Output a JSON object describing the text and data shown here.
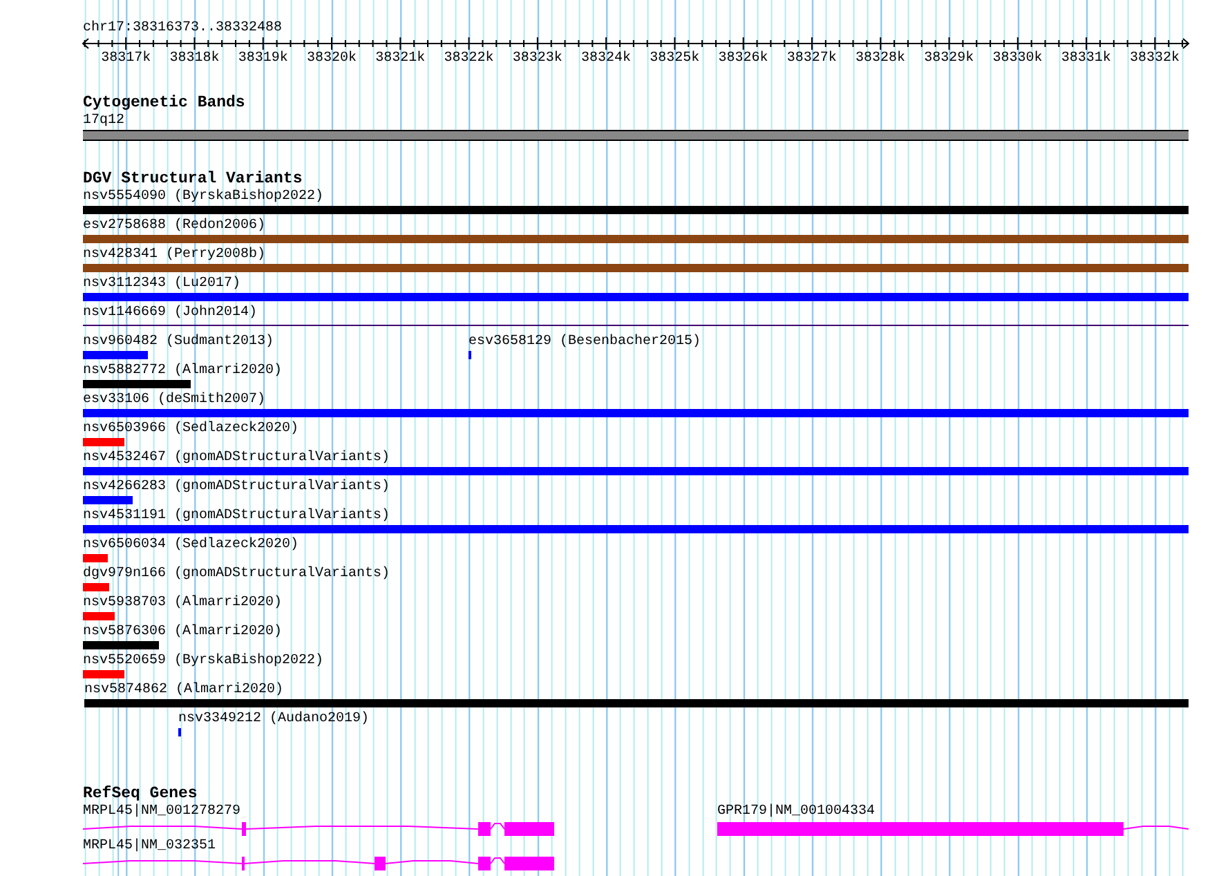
{
  "location": "chr17:38316373..38332488",
  "ruler": {
    "ticks": [
      "38317k",
      "38318k",
      "38319k",
      "38320k",
      "38321k",
      "38322k",
      "38323k",
      "38324k",
      "38325k",
      "38326k",
      "38327k",
      "38328k",
      "38329k",
      "38330k",
      "38331k",
      "38332k"
    ]
  },
  "cytogenetic_bands": {
    "title": "Cytogenetic Bands",
    "band": "17q12"
  },
  "dgv": {
    "title": "DGV Structural Variants",
    "rows": [
      {
        "items": [
          {
            "kind": "bar",
            "label": "nsv5554090 (ByrskaBishop2022)",
            "color": "#000000"
          }
        ]
      },
      {
        "items": [
          {
            "kind": "bar",
            "label": "esv2758688 (Redon2006)",
            "color": "#8b4513"
          }
        ]
      },
      {
        "items": [
          {
            "kind": "bar",
            "label": "nsv428341 (Perry2008b)",
            "color": "#8b4513"
          }
        ]
      },
      {
        "items": [
          {
            "kind": "bar",
            "label": "nsv3112343 (Lu2017)",
            "color": "#0000ff"
          }
        ]
      },
      {
        "items": [
          {
            "kind": "line",
            "label": "nsv1146669 (John2014)",
            "color": "#400070"
          }
        ]
      },
      {
        "items": [
          {
            "kind": "bar",
            "label": "nsv960482 (Sudmant2013)",
            "color": "#0000ff"
          },
          {
            "kind": "bar",
            "label": "esv3658129 (Besenbacher2015)",
            "color": "#0000ff"
          }
        ]
      },
      {
        "items": [
          {
            "kind": "bar",
            "label": "nsv5882772 (Almarri2020)",
            "color": "#000000"
          }
        ]
      },
      {
        "items": [
          {
            "kind": "bar",
            "label": "esv33106 (deSmith2007)",
            "color": "#0000ff"
          }
        ]
      },
      {
        "items": [
          {
            "kind": "bar",
            "label": "nsv6503966 (Sedlazeck2020)",
            "color": "#ff0000"
          }
        ]
      },
      {
        "items": [
          {
            "kind": "bar",
            "label": "nsv4532467 (gnomADStructuralVariants)",
            "color": "#0000ff"
          }
        ]
      },
      {
        "items": [
          {
            "kind": "bar",
            "label": "nsv4266283 (gnomADStructuralVariants)",
            "color": "#0000ff"
          }
        ]
      },
      {
        "items": [
          {
            "kind": "bar",
            "label": "nsv4531191 (gnomADStructuralVariants)",
            "color": "#0000ff"
          }
        ]
      },
      {
        "items": [
          {
            "kind": "bar",
            "label": "nsv6506034 (Sedlazeck2020)",
            "color": "#ff0000"
          }
        ]
      },
      {
        "items": [
          {
            "kind": "bar",
            "label": "dgv979n166 (gnomADStructuralVariants)",
            "color": "#ff0000"
          }
        ]
      },
      {
        "items": [
          {
            "kind": "bar",
            "label": "nsv5938703 (Almarri2020)",
            "color": "#ff0000"
          }
        ]
      },
      {
        "items": [
          {
            "kind": "bar",
            "label": "nsv5876306 (Almarri2020)",
            "color": "#000000"
          }
        ]
      },
      {
        "items": [
          {
            "kind": "bar",
            "label": "nsv5520659 (ByrskaBishop2022)",
            "color": "#ff0000"
          }
        ]
      },
      {
        "items": [
          {
            "kind": "bar",
            "label": "nsv5874862 (Almarri2020)",
            "color": "#000000"
          }
        ]
      },
      {
        "items": [
          {
            "kind": "bar",
            "label": "nsv3349212 (Audano2019)",
            "color": "#0000ff"
          }
        ]
      }
    ]
  },
  "refseq": {
    "title": "RefSeq Genes",
    "rows": [
      {
        "items": [
          {
            "label": "MRPL45|NM_001278279"
          },
          {
            "label": "GPR179|NM_001004334"
          }
        ]
      },
      {
        "items": [
          {
            "label": "MRPL45|NM_032351"
          }
        ]
      }
    ]
  }
}
